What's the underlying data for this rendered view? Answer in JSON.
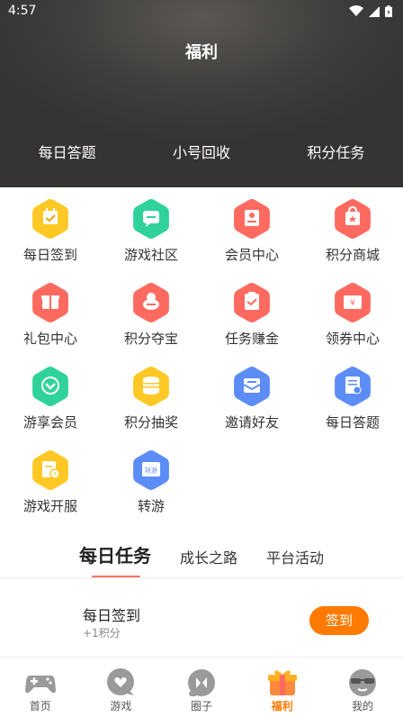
{
  "status_bar": {
    "time": "4:57"
  },
  "header": {
    "title": "福利",
    "tabs": [
      "每日答题",
      "小号回收",
      "积分任务"
    ]
  },
  "grid": [
    {
      "label": "每日签到",
      "icon": "calendar-check-icon",
      "color": "#ffc824"
    },
    {
      "label": "游戏社区",
      "icon": "chat-bubble-icon",
      "color": "#2fd39a"
    },
    {
      "label": "会员中心",
      "icon": "member-card-icon",
      "color": "#ff6a60"
    },
    {
      "label": "积分商城",
      "icon": "shop-bag-icon",
      "color": "#ff6a60"
    },
    {
      "label": "礼包中心",
      "icon": "gift-box-icon",
      "color": "#ff6a60"
    },
    {
      "label": "积分夺宝",
      "icon": "treasure-icon",
      "color": "#ff6a60"
    },
    {
      "label": "任务赚金",
      "icon": "clipboard-check-icon",
      "color": "#ff6a60"
    },
    {
      "label": "领券中心",
      "icon": "coupon-icon",
      "color": "#ff6a60"
    },
    {
      "label": "游享会员",
      "icon": "vip-chevron-icon",
      "color": "#2fd39a"
    },
    {
      "label": "积分抽奖",
      "icon": "coin-stack-icon",
      "color": "#ffc824"
    },
    {
      "label": "邀请好友",
      "icon": "invite-mail-icon",
      "color": "#5c8df6"
    },
    {
      "label": "每日答题",
      "icon": "quiz-sheet-icon",
      "color": "#5c8df6"
    },
    {
      "label": "游戏开服",
      "icon": "server-clock-icon",
      "color": "#ffc824"
    },
    {
      "label": "转游",
      "icon": "transfer-game-icon",
      "color": "#5c8df6"
    }
  ],
  "task_tabs": {
    "items": [
      "每日任务",
      "成长之路",
      "平台活动"
    ],
    "active": 0
  },
  "task": {
    "title": "每日签到",
    "reward": "+1积分",
    "button": "签到"
  },
  "bottom_nav": {
    "items": [
      {
        "label": "首页",
        "icon": "gamepad-icon"
      },
      {
        "label": "游戏",
        "icon": "heart-bubble-icon"
      },
      {
        "label": "圈子",
        "icon": "circle-chat-icon"
      },
      {
        "label": "福利",
        "icon": "gift-box-icon"
      },
      {
        "label": "我的",
        "icon": "sunglasses-face-icon"
      }
    ],
    "active": 3
  },
  "colors": {
    "accent": "#ff7a00",
    "header_bg": "#3f3d3b",
    "tab_underline": "#ff6f61"
  }
}
